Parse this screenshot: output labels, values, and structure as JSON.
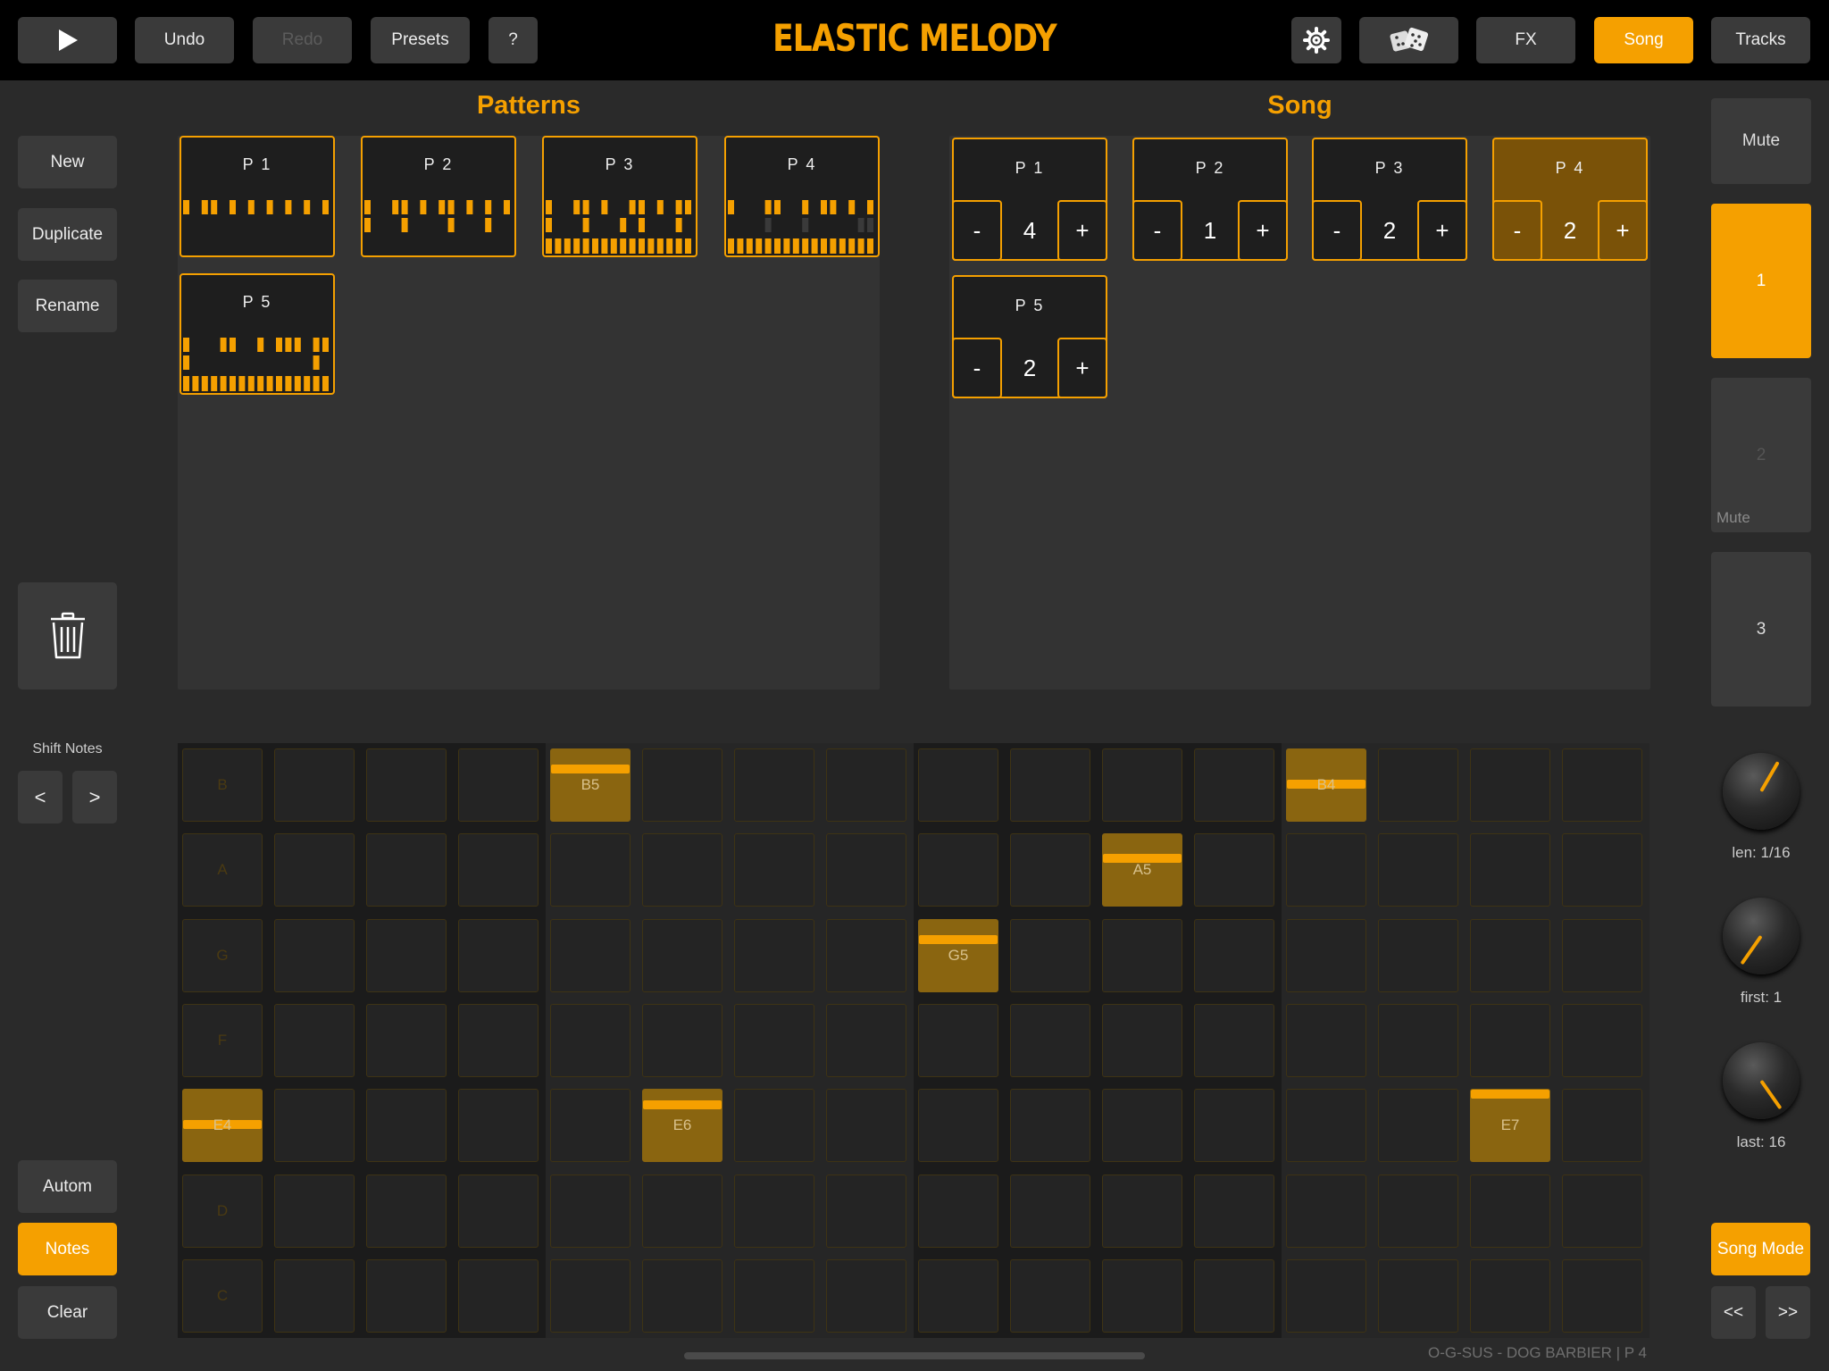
{
  "topbar": {
    "play_icon": "play-icon",
    "undo_label": "Undo",
    "redo_label": "Redo",
    "presets_label": "Presets",
    "help_label": "?",
    "app_title": "ELASTIC MELODY",
    "settings_icon": "gear-icon",
    "dice_icon": "dice-icon",
    "fx_label": "FX",
    "song_label": "Song",
    "tracks_label": "Tracks",
    "accent_color": "#f5a000"
  },
  "sidebar": {
    "new_label": "New",
    "duplicate_label": "Duplicate",
    "rename_label": "Rename",
    "trash_icon": "trash-icon"
  },
  "patterns": {
    "title": "Patterns",
    "items": [
      {
        "label": "P 1",
        "steps": [
          [
            1,
            0,
            1,
            1,
            0,
            1,
            0,
            1,
            0,
            1,
            0,
            1,
            0,
            1,
            0,
            1
          ]
        ],
        "rows": 1
      },
      {
        "label": "P 2",
        "steps": [
          [
            1,
            0,
            0,
            1,
            1,
            0,
            1,
            0,
            1,
            1,
            0,
            1,
            0,
            1,
            0,
            1
          ],
          [
            1,
            0,
            0,
            0,
            1,
            0,
            0,
            0,
            0,
            1,
            0,
            0,
            0,
            1,
            0,
            0
          ]
        ],
        "rows": 2
      },
      {
        "label": "P 3",
        "steps": [
          [
            1,
            0,
            0,
            1,
            1,
            0,
            1,
            0,
            0,
            1,
            1,
            0,
            1,
            0,
            1,
            1
          ],
          [
            1,
            0,
            0,
            0,
            1,
            0,
            0,
            0,
            1,
            0,
            1,
            0,
            0,
            0,
            1,
            0
          ],
          [
            1,
            1,
            1,
            1,
            1,
            1,
            1,
            1,
            1,
            1,
            1,
            1,
            1,
            1,
            1,
            1
          ]
        ],
        "rows": 3
      },
      {
        "label": "P 4",
        "steps": [
          [
            1,
            0,
            0,
            0,
            1,
            1,
            0,
            0,
            1,
            0,
            1,
            1,
            0,
            1,
            0,
            1
          ],
          [
            0,
            0,
            0,
            0,
            2,
            0,
            0,
            0,
            2,
            0,
            0,
            0,
            0,
            0,
            2,
            2
          ],
          [
            1,
            1,
            1,
            1,
            1,
            1,
            1,
            1,
            1,
            1,
            1,
            1,
            1,
            1,
            1,
            1
          ]
        ],
        "rows": 3
      },
      {
        "label": "P 5",
        "steps": [
          [
            1,
            0,
            0,
            0,
            1,
            1,
            0,
            0,
            1,
            0,
            1,
            1,
            1,
            0,
            1,
            1
          ],
          [
            1,
            0,
            0,
            0,
            0,
            0,
            0,
            0,
            0,
            0,
            0,
            0,
            0,
            0,
            1,
            0
          ],
          [
            1,
            1,
            1,
            1,
            1,
            1,
            1,
            1,
            1,
            1,
            1,
            1,
            1,
            1,
            1,
            1
          ]
        ],
        "rows": 3
      }
    ]
  },
  "song": {
    "title": "Song",
    "items": [
      {
        "label": "P 1",
        "count": "4",
        "selected": false
      },
      {
        "label": "P 2",
        "count": "1",
        "selected": false
      },
      {
        "label": "P 3",
        "count": "2",
        "selected": false
      },
      {
        "label": "P 4",
        "count": "2",
        "selected": true
      },
      {
        "label": "P 5",
        "count": "2",
        "selected": false
      }
    ],
    "minus_label": "-",
    "plus_label": "+"
  },
  "tracks": {
    "mute_label": "Mute",
    "items": [
      {
        "label": "1",
        "state": "active",
        "sub": ""
      },
      {
        "label": "2",
        "state": "muted",
        "sub": "Mute"
      },
      {
        "label": "3",
        "state": "normal",
        "sub": ""
      }
    ]
  },
  "shift": {
    "title": "Shift Notes",
    "left_label": "<",
    "right_label": ">"
  },
  "modes": {
    "autom_label": "Autom",
    "notes_label": "Notes",
    "clear_label": "Clear"
  },
  "grid": {
    "rows": [
      "B",
      "A",
      "G",
      "F",
      "E",
      "D",
      "C"
    ],
    "notes": [
      {
        "row": 0,
        "col": 4,
        "label": "B5",
        "bar": 0.25
      },
      {
        "row": 0,
        "col": 12,
        "label": "B4",
        "bar": 0.5
      },
      {
        "row": 1,
        "col": 10,
        "label": "A5",
        "bar": 0.33
      },
      {
        "row": 2,
        "col": 8,
        "label": "G5",
        "bar": 0.25
      },
      {
        "row": 4,
        "col": 0,
        "label": "E4",
        "bar": 0.5
      },
      {
        "row": 4,
        "col": 5,
        "label": "E6",
        "bar": 0.17
      },
      {
        "row": 4,
        "col": 14,
        "label": "E7",
        "bar": 0.0
      }
    ]
  },
  "knobs": [
    {
      "label": "len: 1/16",
      "angle": 210
    },
    {
      "label": "first: 1",
      "angle": 35
    },
    {
      "label": "last: 16",
      "angle": -35
    }
  ],
  "transport": {
    "song_mode_label": "Song Mode",
    "rewind_label": "<<",
    "forward_label": ">>"
  },
  "footer": {
    "info": "O-G-SUS - DOG BARBIER  |  P 4"
  }
}
